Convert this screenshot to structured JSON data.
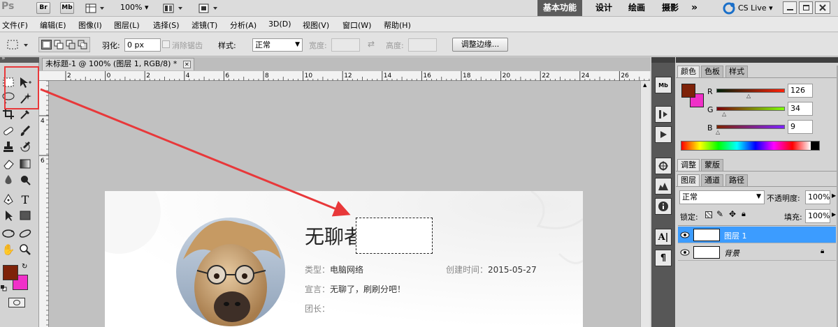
{
  "app": {
    "logo": "Ps",
    "bridge_btn": "Br",
    "minibridge_btn": "Mb",
    "zoom": "100%",
    "workspaces": [
      "基本功能",
      "设计",
      "绘画",
      "摄影"
    ],
    "active_workspace": "基本功能",
    "more_workspaces": "»",
    "cs_live": "CS Live"
  },
  "menu": [
    "文件(F)",
    "编辑(E)",
    "图像(I)",
    "图层(L)",
    "选择(S)",
    "滤镜(T)",
    "分析(A)",
    "3D(D)",
    "视图(V)",
    "窗口(W)",
    "帮助(H)"
  ],
  "options": {
    "feather_label": "羽化:",
    "feather_value": "0 px",
    "antialias_label": "消除锯齿",
    "style_label": "样式:",
    "style_value": "正常",
    "width_label": "宽度:",
    "height_label": "高度:",
    "refine_edge_btn": "调整边缘..."
  },
  "document": {
    "tab_title": "未标题-1 @ 100% (图层 1, RGB/8) *",
    "close_glyph": "✕",
    "ruler_top": [
      "2",
      "0",
      "2",
      "4",
      "6",
      "8",
      "10",
      "12",
      "14",
      "16",
      "18",
      "20",
      "22",
      "24",
      "26"
    ],
    "ruler_left": [
      "4",
      "6"
    ]
  },
  "card": {
    "title": "无聊者",
    "type_label": "类型：",
    "type_value": "电脑网络",
    "created_label": "创建时间：",
    "created_value": "2015-05-27",
    "slogan_label": "宣言：",
    "slogan_value": "无聊了，刷刷分吧！",
    "leader_label": "团长："
  },
  "color_panel": {
    "tabs": [
      "颜色",
      "色板",
      "样式"
    ],
    "r_label": "R",
    "r_value": "126",
    "g_label": "G",
    "g_value": "34",
    "b_label": "B",
    "b_value": "9",
    "fg_color": "#7e2209",
    "bg_color": "#f030c8"
  },
  "adjust_panel": {
    "tabs": [
      "调整",
      "蒙版"
    ]
  },
  "layers_panel": {
    "tabs": [
      "图层",
      "通道",
      "路径"
    ],
    "blend_mode": "正常",
    "opacity_label": "不透明度:",
    "opacity_value": "100%",
    "lock_label": "锁定:",
    "fill_label": "填充:",
    "fill_value": "100%",
    "layers": [
      {
        "name": "图层 1",
        "selected": true,
        "locked": false
      },
      {
        "name": "背景",
        "selected": false,
        "locked": true
      }
    ]
  },
  "toolbox": {
    "fg_color": "#7e2209",
    "bg_color": "#f030c8"
  },
  "annotation": {
    "color": "#e8383a"
  }
}
